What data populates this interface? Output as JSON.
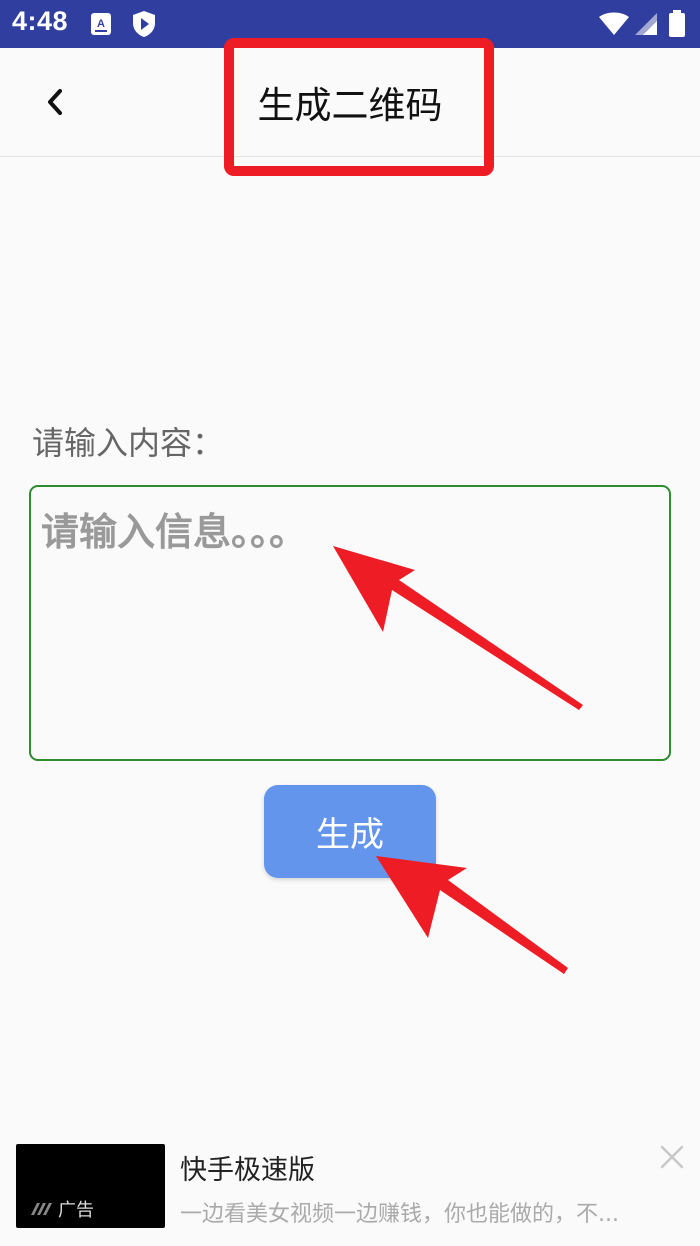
{
  "status_bar": {
    "time": "4:48",
    "background": "#303f9f",
    "icons": [
      "font-download-icon",
      "shield-play-icon",
      "wifi-icon",
      "signal-icon",
      "battery-icon"
    ]
  },
  "toolbar": {
    "back_icon": "chevron-left-icon",
    "title": "生成二维码",
    "title_highlight_color": "#ee1c25"
  },
  "form": {
    "label": "请输入内容：",
    "input_value": "",
    "input_placeholder": "请输入信息。。。",
    "input_border_color": "#2e8b2e",
    "button_label": "生成",
    "button_color": "#6495ed"
  },
  "annotations": {
    "arrow_color": "#ee1c25"
  },
  "ad": {
    "badge": "广告",
    "title": "快手极速版",
    "description": "一边看美女视频一边赚钱，你也能做的，不...",
    "close_icon": "close-icon"
  }
}
